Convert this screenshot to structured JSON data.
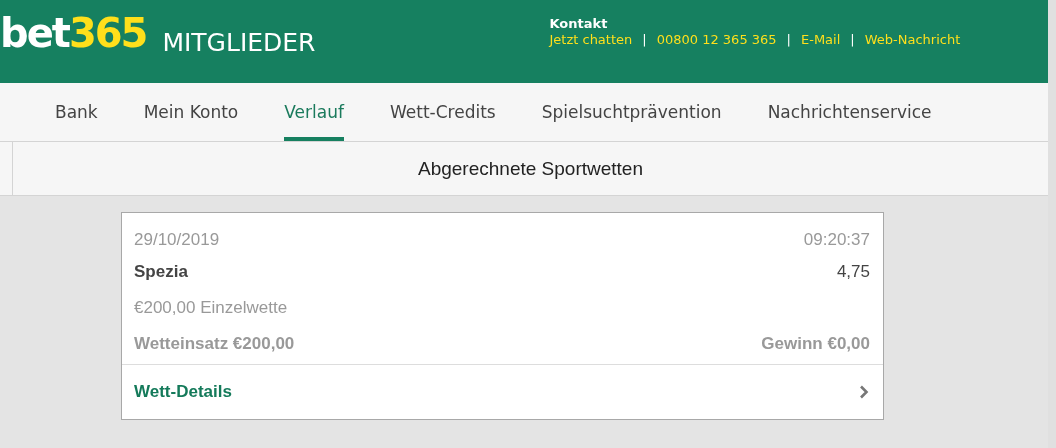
{
  "header": {
    "logo": {
      "word": "bet",
      "number": "365"
    },
    "section": "MITGLIEDER",
    "contact": {
      "title": "Kontakt",
      "separator": "|",
      "links": [
        "Jetzt chatten",
        "00800 12 365 365",
        "E-Mail",
        "Web-Nachricht"
      ]
    }
  },
  "nav": [
    {
      "label": "Bank",
      "selected": false
    },
    {
      "label": "Mein Konto",
      "selected": false
    },
    {
      "label": "Verlauf",
      "selected": true
    },
    {
      "label": "Wett-Credits",
      "selected": false
    },
    {
      "label": "Spielsuchtprävention",
      "selected": false
    },
    {
      "label": "Nachrichtenservice",
      "selected": false
    }
  ],
  "subheader": {
    "title": "Abgerechnete Sportwetten"
  },
  "bet": {
    "date": "29/10/2019",
    "time": "09:20:37",
    "selection": "Spezia",
    "odds": "4,75",
    "type": "€200,00 Einzelwette",
    "stake": "Wetteinsatz €200,00",
    "return": "Gewinn €0,00",
    "details": "Wett-Details"
  }
}
